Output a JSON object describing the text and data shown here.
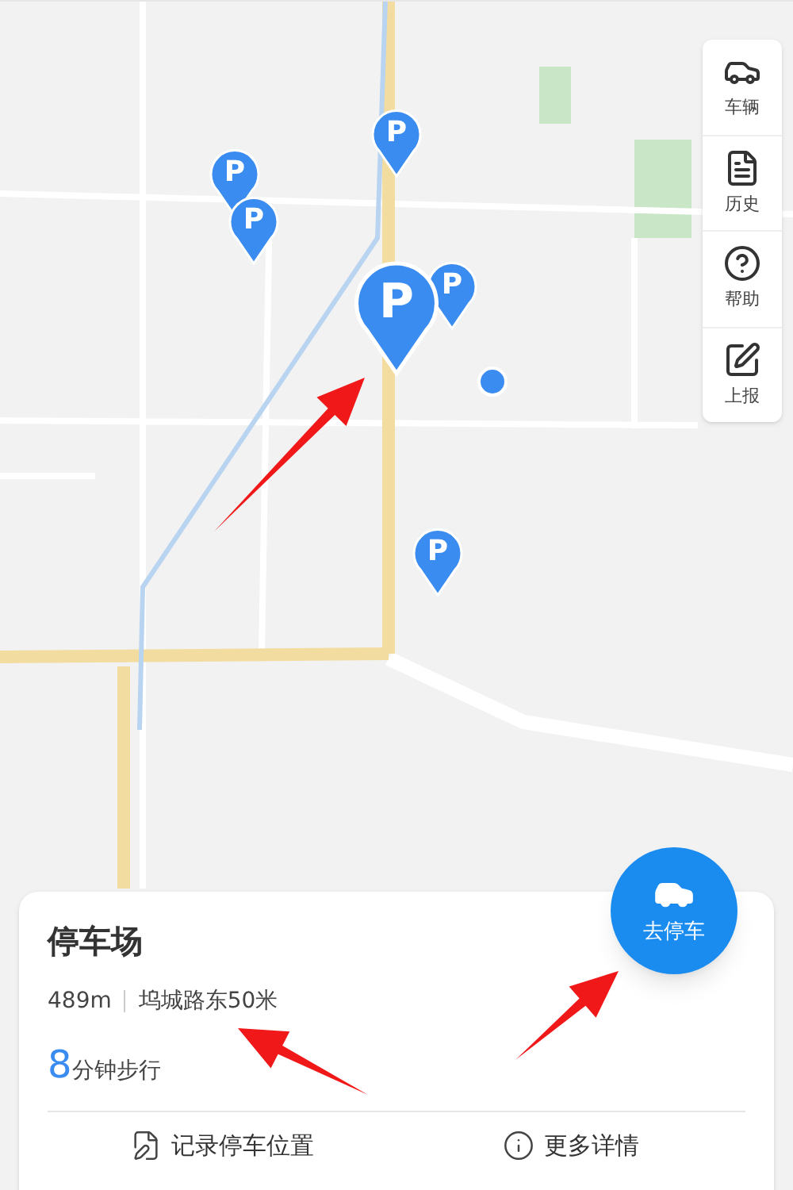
{
  "map": {
    "markers": [
      {
        "label": "P",
        "selected": false
      },
      {
        "label": "P",
        "selected": false
      },
      {
        "label": "P",
        "selected": false
      },
      {
        "label": "P",
        "selected": false
      },
      {
        "label": "P",
        "selected": true
      },
      {
        "label": "P",
        "selected": false
      }
    ]
  },
  "toolbar": [
    {
      "label": "车辆",
      "kind": "car"
    },
    {
      "label": "历史",
      "kind": "history"
    },
    {
      "label": "帮助",
      "kind": "help"
    },
    {
      "label": "上报",
      "kind": "report"
    }
  ],
  "go_button": {
    "label": "去停车"
  },
  "card": {
    "title": "停车场",
    "distance": "489m",
    "address": "坞城路东50米",
    "walk_minutes": "8",
    "walk_unit": "分钟步行",
    "actions": [
      {
        "label": "记录停车位置",
        "kind": "record"
      },
      {
        "label": "更多详情",
        "kind": "info"
      }
    ]
  }
}
